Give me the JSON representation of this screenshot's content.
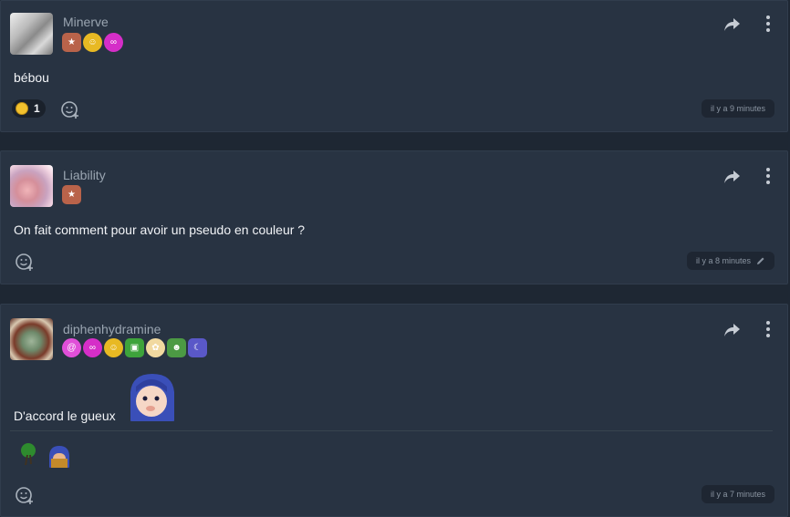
{
  "posts": [
    {
      "username": "Minerve",
      "badges": [
        "bronze-star",
        "smiley-gold",
        "pink-infinity"
      ],
      "content": "bébou",
      "reaction_count": "1",
      "time": "il y a 9 minutes",
      "edited": false
    },
    {
      "username": "Liability",
      "badges": [
        "bronze-star"
      ],
      "content": "On fait comment pour avoir un pseudo en couleur ?",
      "time": "il y a 8 minutes",
      "edited": true
    },
    {
      "username": "diphenhydramine",
      "badges": [
        "pink-spiral",
        "pink-infinity",
        "smiley-gold",
        "green-box",
        "anime-girl",
        "green-smiley",
        "moon-purple"
      ],
      "content": "D'accord le gueux",
      "time": "il y a 7 minutes",
      "edited": false
    }
  ],
  "colors": {
    "background": "#1e2733",
    "card": "#283342",
    "username": "#9aa5b1",
    "time": "#8a94a1"
  }
}
